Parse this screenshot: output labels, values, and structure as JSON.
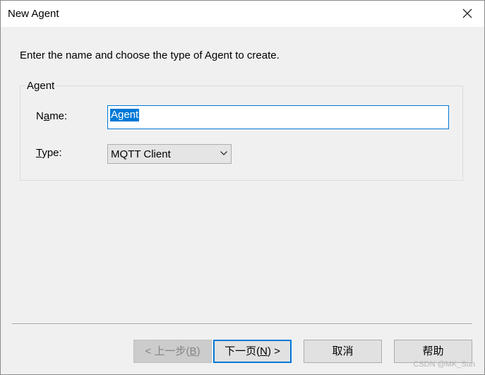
{
  "window": {
    "title": "New Agent"
  },
  "instruction": "Enter the name and choose the type of Agent to create.",
  "group": {
    "label": "Agent",
    "name_label_pre": "N",
    "name_label_accel": "a",
    "name_label_post": "me:",
    "name_value": "Agent",
    "type_label_accel": "T",
    "type_label_post": "ype:",
    "type_value": "MQTT Client"
  },
  "buttons": {
    "back_pre": "< 上一步(",
    "back_accel": "B",
    "back_post": ")",
    "next_pre": "下一页(",
    "next_accel": "N",
    "next_post": ") >",
    "cancel": "取消",
    "help": "帮助"
  },
  "watermark": "CSDN @MK_Sun",
  "icons": {
    "close": "close-icon",
    "dropdown": "chevron-down-icon"
  },
  "colors": {
    "accent": "#0078d7",
    "background": "#f0f0f0"
  }
}
